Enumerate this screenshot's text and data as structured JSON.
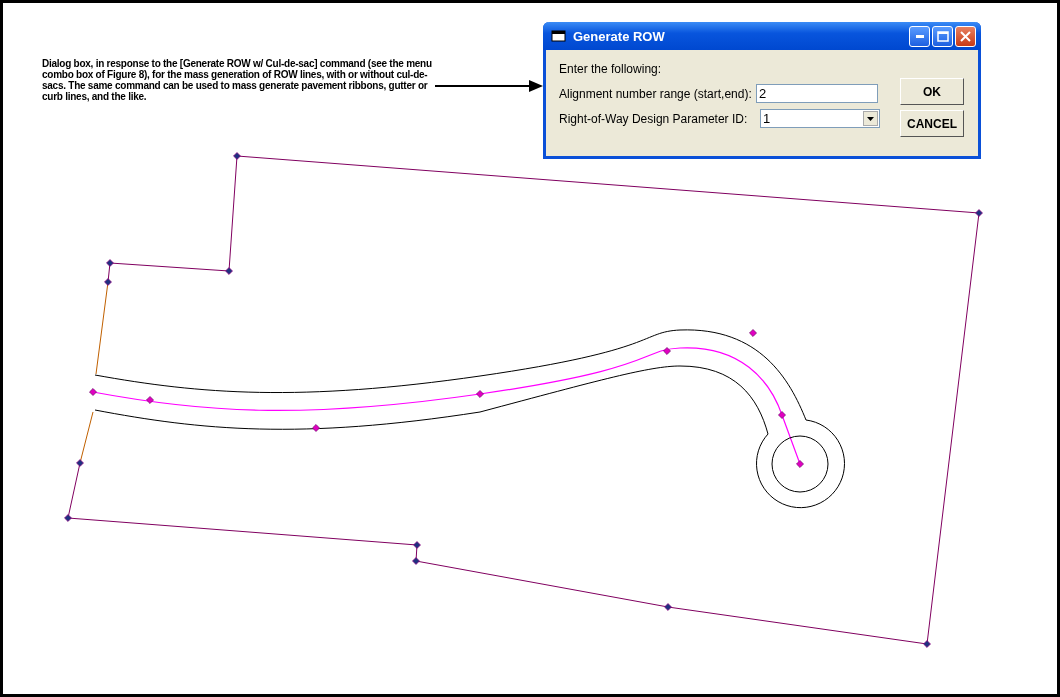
{
  "caption": "Dialog box, in response to the [Generate ROW w/ Cul-de-sac] command (see the menu combo box of Figure 8), for the mass generation of ROW lines, with or without cul-de-sacs.  The same command can be used to mass generate pavement ribbons, gutter or curb lines, and the like.",
  "dialog": {
    "title": "Generate ROW",
    "prompt": "Enter the following:",
    "fields": [
      {
        "kind": "text",
        "label": "Alignment number range (start,end):",
        "value": "2"
      },
      {
        "kind": "dropdown",
        "label": "Right-of-Way Design Parameter ID:",
        "value": "1"
      }
    ],
    "buttons": [
      "OK",
      "CANCEL"
    ]
  }
}
